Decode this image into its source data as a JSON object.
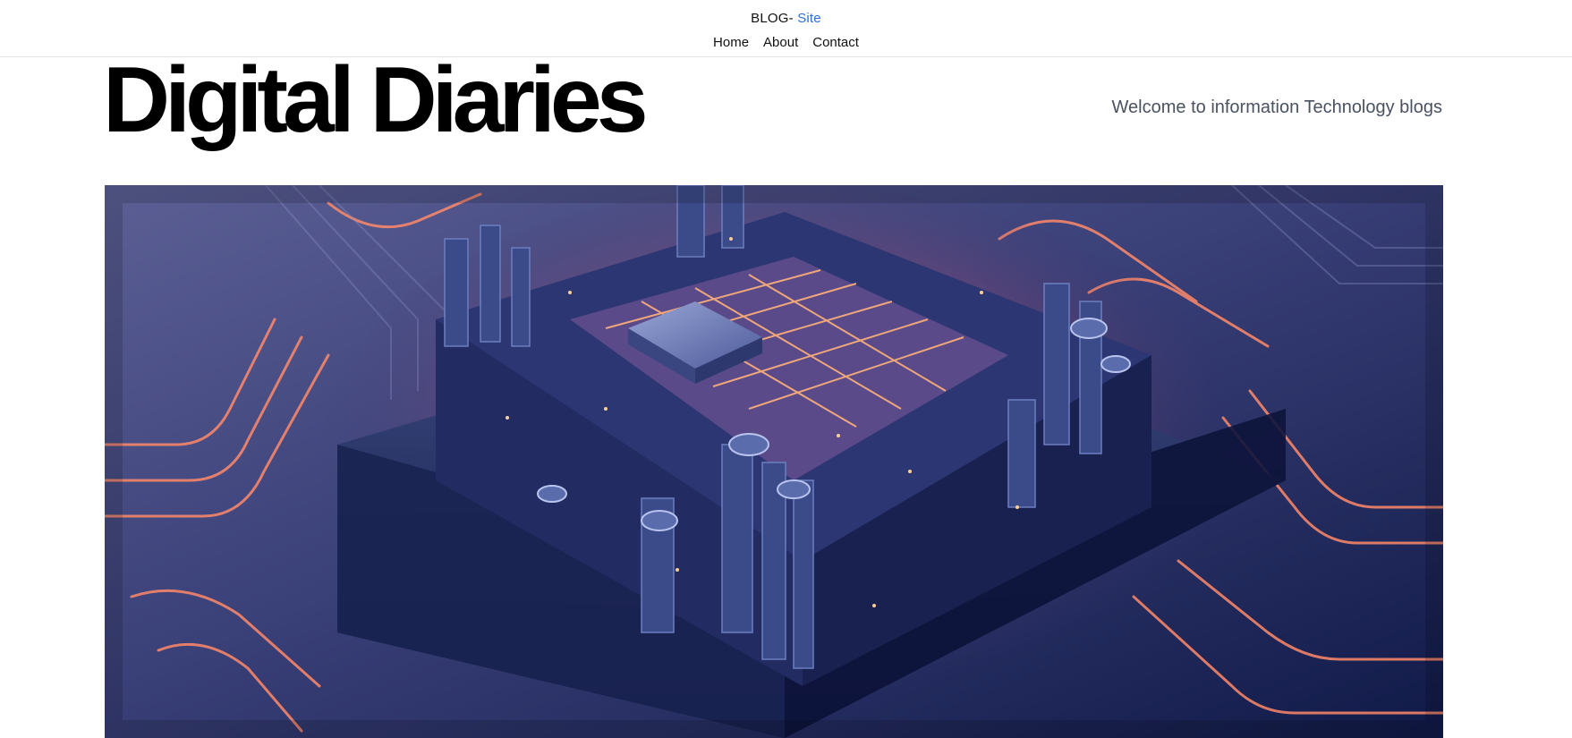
{
  "header": {
    "brand_prefix": "BLOG- ",
    "brand_accent": "Site",
    "accent_color": "#2f6fdc",
    "nav": [
      {
        "label": "Home"
      },
      {
        "label": "About"
      },
      {
        "label": "Contact"
      }
    ]
  },
  "hero": {
    "title": "Digital Diaries",
    "tagline": "Welcome to information Technology blogs",
    "image_subject": "circuit-board-chip"
  }
}
